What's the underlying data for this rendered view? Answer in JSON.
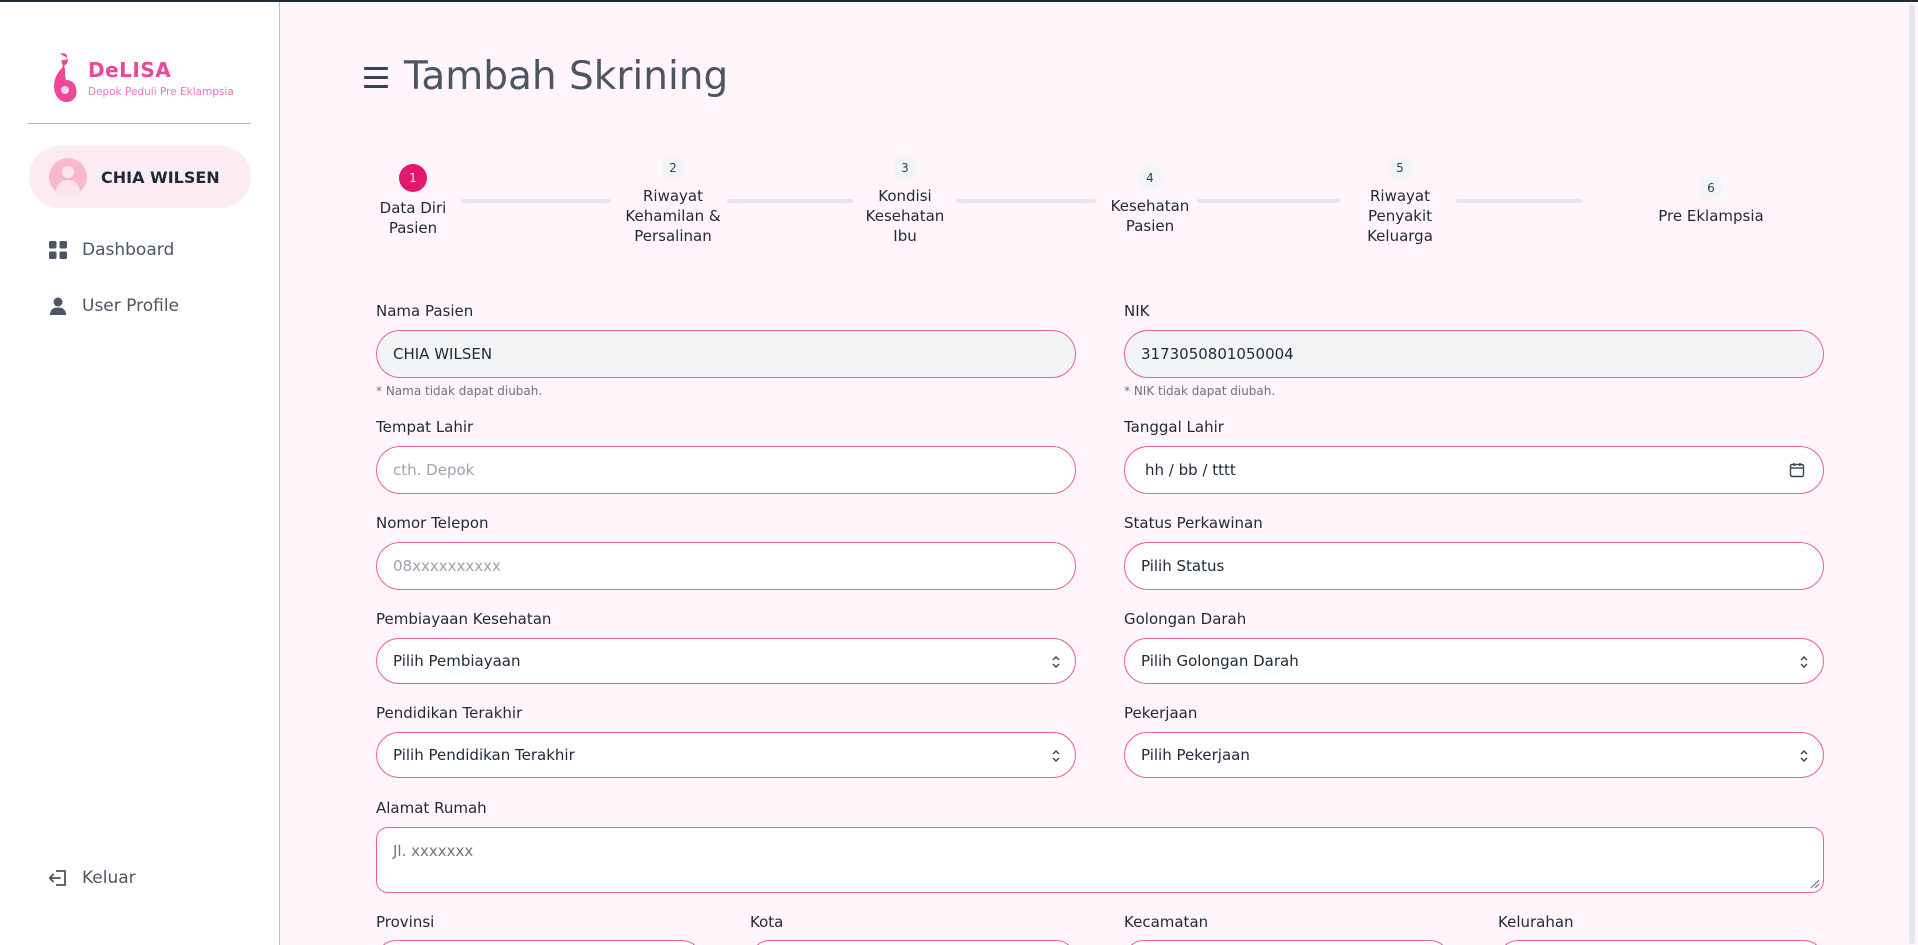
{
  "app": {
    "name": "DeLISA",
    "tagline": "Depok Peduli Pre Eklampsia"
  },
  "colors": {
    "accent": "#ec4899",
    "active_step": "#e5166e",
    "field_border": "#ec5f9a",
    "background": "#fff5fa"
  },
  "user": {
    "name": "CHIA WILSEN"
  },
  "sidebar": {
    "items": [
      {
        "label": "Dashboard",
        "icon": "dashboard-grid-icon"
      },
      {
        "label": "User Profile",
        "icon": "user-icon"
      }
    ],
    "logout_label": "Keluar",
    "logout_icon": "logout-icon"
  },
  "page": {
    "title": "Tambah Skrining"
  },
  "stepper": {
    "current": 1,
    "steps": [
      {
        "number": "1",
        "label_lines": [
          "Data Diri",
          "Pasien"
        ]
      },
      {
        "number": "2",
        "label_lines": [
          "Riwayat",
          "Kehamilan &",
          "Persalinan"
        ]
      },
      {
        "number": "3",
        "label_lines": [
          "Kondisi",
          "Kesehatan",
          "Ibu"
        ]
      },
      {
        "number": "4",
        "label_lines": [
          "Kesehatan",
          "Pasien"
        ]
      },
      {
        "number": "5",
        "label_lines": [
          "Riwayat",
          "Penyakit",
          "Keluarga"
        ]
      },
      {
        "number": "6",
        "label_lines": [
          "Pre Eklampsia"
        ]
      }
    ]
  },
  "form": {
    "nama_pasien": {
      "label": "Nama Pasien",
      "value": "CHIA WILSEN",
      "hint": "* Nama tidak dapat diubah."
    },
    "nik": {
      "label": "NIK",
      "value": "3173050801050004",
      "hint": "* NIK tidak dapat diubah."
    },
    "tempat_lahir": {
      "label": "Tempat Lahir",
      "placeholder": "cth. Depok"
    },
    "tanggal_lahir": {
      "label": "Tanggal Lahir",
      "placeholder": "hh / bb / tttt"
    },
    "nomor_telepon": {
      "label": "Nomor Telepon",
      "placeholder": "08xxxxxxxxxx"
    },
    "status_perkawinan": {
      "label": "Status Perkawinan",
      "value": "Pilih Status"
    },
    "pembiayaan": {
      "label": "Pembiayaan Kesehatan",
      "value": "Pilih Pembiayaan"
    },
    "golongan_darah": {
      "label": "Golongan Darah",
      "value": "Pilih Golongan Darah"
    },
    "pendidikan": {
      "label": "Pendidikan Terakhir",
      "value": "Pilih Pendidikan Terakhir"
    },
    "pekerjaan": {
      "label": "Pekerjaan",
      "value": "Pilih Pekerjaan"
    },
    "alamat": {
      "label": "Alamat Rumah",
      "placeholder": "Jl. xxxxxxx"
    },
    "provinsi": {
      "label": "Provinsi"
    },
    "kota": {
      "label": "Kota"
    },
    "kecamatan": {
      "label": "Kecamatan"
    },
    "kelurahan": {
      "label": "Kelurahan"
    }
  }
}
